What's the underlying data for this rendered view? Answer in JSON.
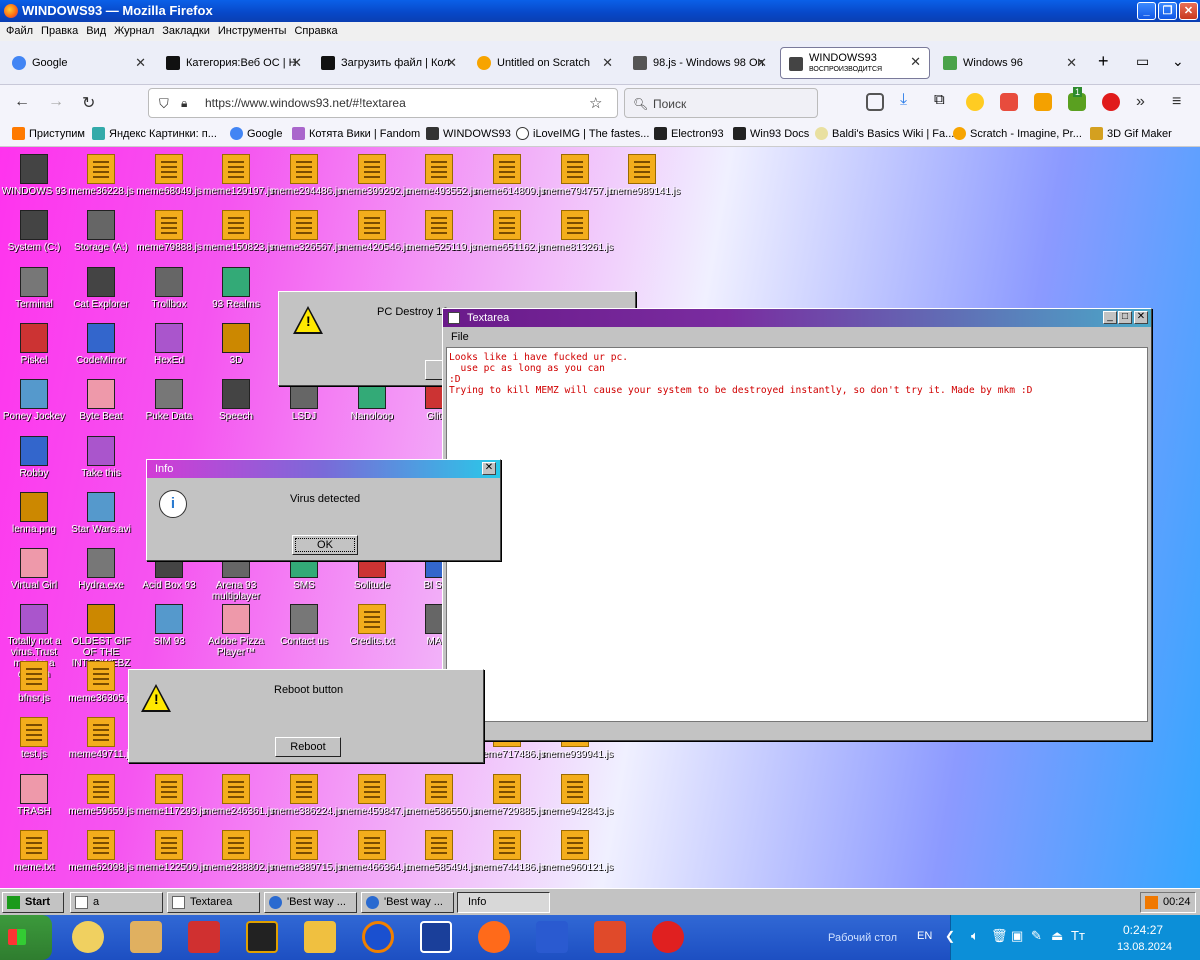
{
  "browser": {
    "title": "WINDOWS93 — Mozilla Firefox",
    "menu": [
      "Файл",
      "Правка",
      "Вид",
      "Журнал",
      "Закладки",
      "Инструменты",
      "Справка"
    ],
    "tabs": [
      {
        "label": "Google",
        "color": "#4285f4"
      },
      {
        "label": "Категория:Веб ОС | Н",
        "color": "#111"
      },
      {
        "label": "Загрузить файл | Кол",
        "color": "#111"
      },
      {
        "label": "Untitled on Scratch",
        "color": "#f7a400"
      },
      {
        "label": "98.js - Windows 98 On",
        "color": "#555"
      },
      {
        "label": "WINDOWS93",
        "sub": "ВОСПРОИЗВОДИТСЯ",
        "color": "#444"
      },
      {
        "label": "Windows 96",
        "color": "#4aa34a"
      }
    ],
    "url": "https://www.windows93.net/#!textarea",
    "search_placeholder": "Поиск",
    "badge": "1",
    "bookmarks": [
      "Приступим",
      "Яндекс Картинки: п...",
      "Google",
      "Котята Вики | Fandom",
      "WINDOWS93",
      "iLoveIMG | The fastes...",
      "Electron93",
      "Win93 Docs",
      "Baldi's Basics Wiki | Fa...",
      "Scratch - Imagine, Pr...",
      "3D Gif Maker"
    ]
  },
  "desktop_icons": [
    "WINDOWS 93",
    "meme36228.js",
    "meme68049.js",
    "meme129197.js",
    "meme294486.js",
    "meme399292.js",
    "meme493552.js",
    "meme614809.js",
    "meme794757.js",
    "meme989141.js",
    "System (C:)",
    "Storage (A:)",
    "meme79888.js",
    "meme150823.js",
    "meme326567.js",
    "meme420546.js",
    "meme525119.js",
    "meme651162.js",
    "meme813261.js",
    "Terminal",
    "Cat Explorer",
    "Trollbox",
    "93 Realms",
    "Piskel",
    "CodeMirror",
    "HexEd",
    "3D",
    "Poney Jockey",
    "Byte Beat",
    "Puke Data",
    "Speech",
    "LSDJ",
    "Nanoloop",
    "Glitch",
    "Robby",
    "Take this",
    "lenna.png",
    "Star Wars.avi",
    "Virtual Girl",
    "Hydra.exe",
    "Acid Box 93",
    "Arena 93 multiplayer",
    "SMS",
    "Solitude",
    "Bl Swe",
    "Totally not a virus.Trust me...im a dolphin",
    "OLDEST GIF OF THE INTERWEBZ .gif",
    "SIM 93",
    "Adobe Pizza Player™",
    "Contact us",
    "Credits.txt",
    "MANI",
    "bfnsr.js",
    "meme36305.js",
    "test.js",
    "meme49711.js",
    "meme717486.js",
    "meme939941.js",
    "TRASH",
    "meme59659.js",
    "meme117293.js",
    "meme246361.js",
    "meme386224.js",
    "meme459847.js",
    "meme586550.js",
    "meme729885.js",
    "meme942843.js",
    "meme.txt",
    "meme62098.js",
    "meme122509.js",
    "meme288802.js",
    "meme389715.js",
    "meme466364.js",
    "meme585494.js",
    "meme744186.js",
    "meme960121.js"
  ],
  "dialogs": {
    "pc_destroy": {
      "title": "",
      "message": "PC Destroy 10"
    },
    "info": {
      "title": "Info",
      "message": "Virus detected",
      "button": "OK"
    },
    "reboot": {
      "title": "",
      "message": "Reboot button",
      "button": "Reboot"
    }
  },
  "textarea": {
    "title": "Textarea",
    "menu": "File",
    "lines": [
      "Looks like i have fucked ur pc.",
      "  use pc as long as you can",
      ":D",
      "Trying to kill MEMZ will cause your system to be destroyed instantly, so don't try it. Made by mkm :D"
    ]
  },
  "taskbar95": {
    "start": "Start",
    "items": [
      "a",
      "Textarea",
      "'Best way ...",
      "'Best way ...",
      "Info"
    ],
    "clock": "00:24"
  },
  "windows_taskbar": {
    "desktop_label": "Рабочий стол",
    "lang": "EN",
    "time": "0:24:27",
    "date": "13.08.2024"
  }
}
